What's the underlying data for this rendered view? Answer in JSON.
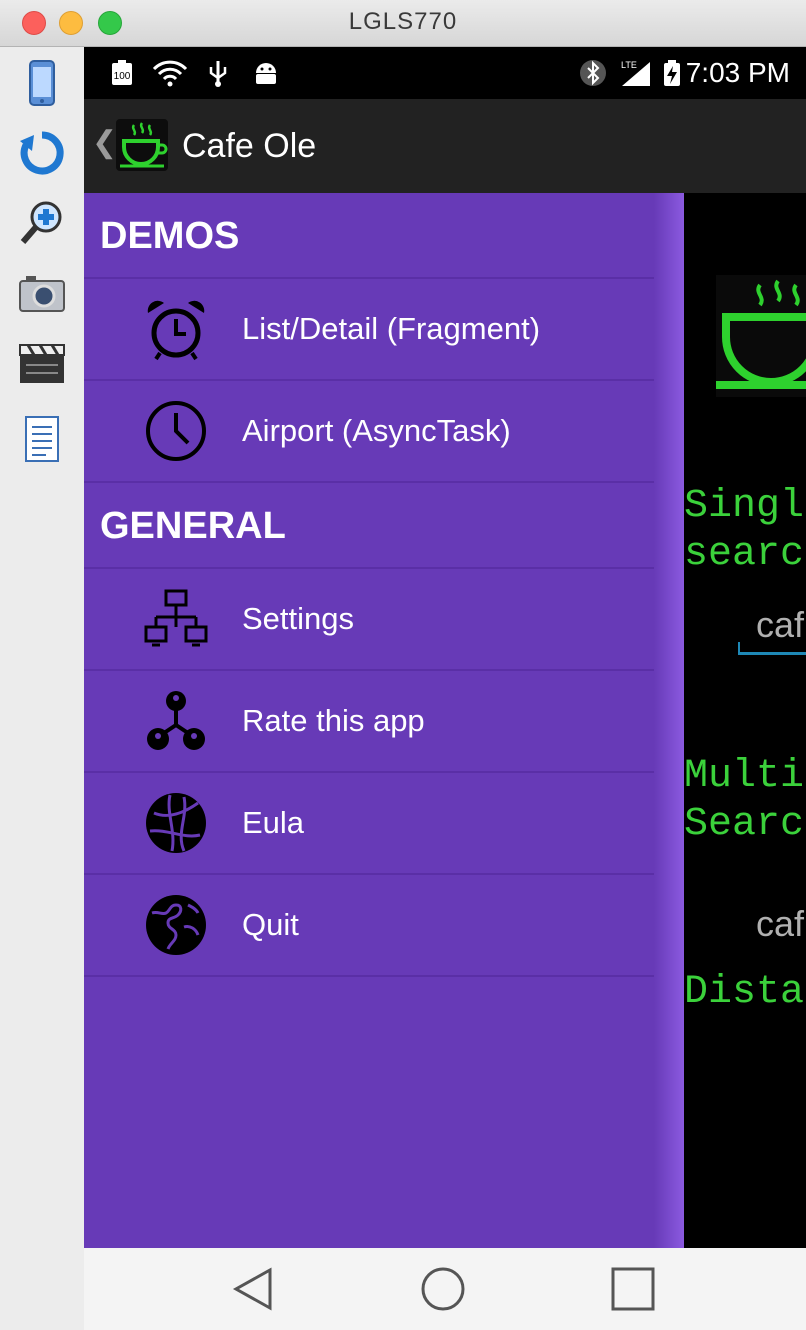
{
  "window": {
    "title": "LGLS770"
  },
  "status_bar": {
    "time": "7:03 PM",
    "battery_level": "100",
    "network": "LTE"
  },
  "action_bar": {
    "title": "Cafe Ole",
    "back_glyph": "❮"
  },
  "drawer": {
    "sections": [
      {
        "title": "DEMOS",
        "items": [
          {
            "label": "List/Detail (Fragment)",
            "icon": "alarm-clock-icon"
          },
          {
            "label": "Airport (AsyncTask)",
            "icon": "clock-icon"
          }
        ]
      },
      {
        "title": "GENERAL",
        "items": [
          {
            "label": "Settings",
            "icon": "network-icon"
          },
          {
            "label": "Rate this app",
            "icon": "people-network-icon"
          },
          {
            "label": "Eula",
            "icon": "globe-grid-icon"
          },
          {
            "label": "Quit",
            "icon": "earth-icon"
          }
        ]
      }
    ]
  },
  "background": {
    "single_label": "Singl\nsearc",
    "single_input": "caf",
    "multi_label": "Multi\nSearc",
    "multi_value": "caf",
    "distance_label": "Dista"
  },
  "colors": {
    "drawer": "#673ab7",
    "accent_green": "#3bd13b",
    "input_line": "#1e88b6"
  }
}
